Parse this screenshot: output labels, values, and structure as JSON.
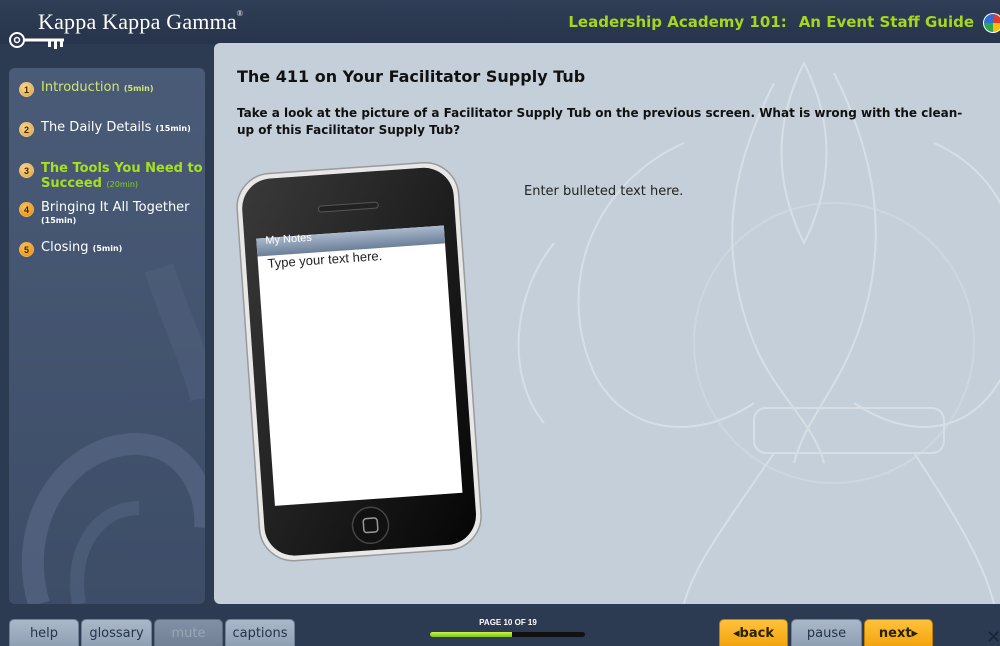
{
  "header": {
    "logo_text": "Kappa Kappa Gamma",
    "logo_mark": "®",
    "course_title_a": "Leadership Academy 101:",
    "course_title_b": "An Event Staff Guide"
  },
  "sidebar": {
    "items": [
      {
        "num": "1",
        "label": "Introduction",
        "duration": "(5min)",
        "state": "visited"
      },
      {
        "num": "2",
        "label": "The Daily Details",
        "duration": "(15min)",
        "state": "normal"
      },
      {
        "num": "3",
        "label_line1": "The Tools You Need to",
        "label_line2": "Succeed",
        "duration": "(20min)",
        "state": "current"
      },
      {
        "num": "4",
        "label": "Bringing It All Together",
        "duration": "(15min)",
        "state": "normal"
      },
      {
        "num": "5",
        "label": "Closing",
        "duration": "(5min)",
        "state": "normal"
      }
    ]
  },
  "slide": {
    "title": "The 411 on Your Facilitator Supply Tub",
    "question": "Take a look at the picture of a Facilitator Supply Tub on the previous screen. What is wrong with the clean-up of this Facilitator Supply Tub?",
    "bullet_placeholder": "Enter bulleted text here.",
    "phone": {
      "notes_header": "My Notes",
      "notes_body": "Type your text here."
    }
  },
  "footer": {
    "help": "help",
    "glossary": "glossary",
    "mute": "mute",
    "captions": "captions",
    "page_label": "PAGE 10 OF 19",
    "progress_fraction": 0.53,
    "back": "◂back",
    "pause": "pause",
    "next": "next▸"
  },
  "colors": {
    "accent_green": "#a6d61e",
    "nav_orange": "#f2a10a",
    "content_bg": "#c5cfd9",
    "frame_bg": "#2c3a52"
  },
  "icons": [
    "key-icon",
    "globe-icon",
    "close-icon"
  ]
}
